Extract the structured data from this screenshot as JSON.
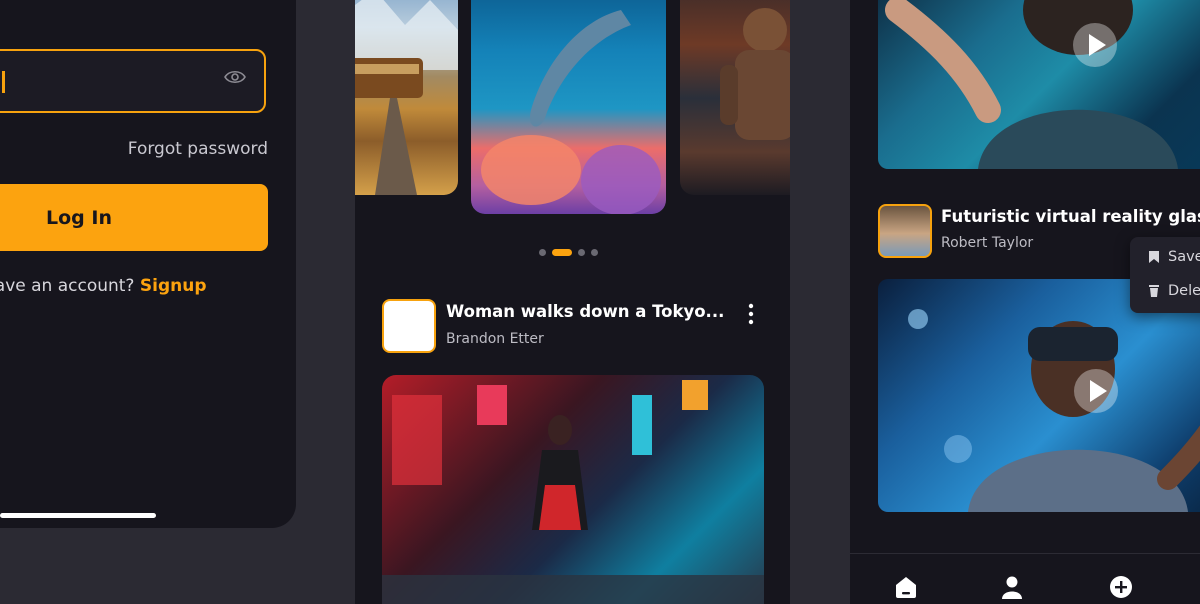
{
  "login": {
    "forgot_password": "Forgot password",
    "login_button": "Log In",
    "signup_prompt": "have an account? ",
    "signup_link": "Signup"
  },
  "feed": {
    "carousel": {
      "images": [
        "train-landscape",
        "dolphin-coral-reef",
        "deep-sea-diver"
      ],
      "page_count": 4,
      "active_page": 2
    },
    "post": {
      "title": "Woman walks down a Tokyo...",
      "author": "Brandon Etter"
    }
  },
  "video": {
    "post": {
      "title": "Futuristic virtual reality glasses",
      "author": "Robert Taylor"
    },
    "context_menu": {
      "save": "Save",
      "delete": "Dele"
    },
    "nav": [
      "home-icon",
      "profile-icon",
      "add-icon"
    ]
  },
  "colors": {
    "accent": "#fca30f",
    "background": "#16151d",
    "page": "#2b2a33"
  }
}
